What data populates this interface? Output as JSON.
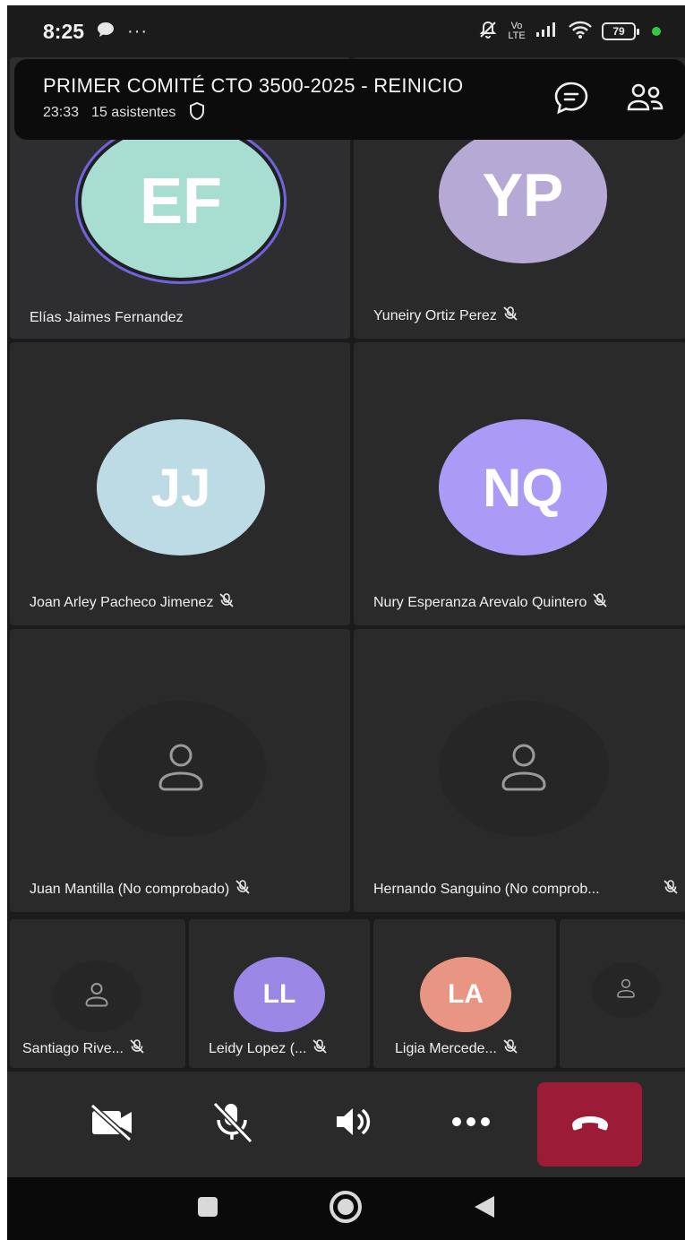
{
  "status_bar": {
    "time": "8:25",
    "more": "···",
    "network": "Vo LTE",
    "battery": "79"
  },
  "meeting": {
    "title": "PRIMER COMITÉ CTO 3500-2025 - REINICIO",
    "duration": "23:33",
    "attendees": "15 asistentes"
  },
  "participants": [
    {
      "initials": "EF",
      "name": "Elías Jaimes Fernandez",
      "color": "#a8ded2",
      "muted": false,
      "speaking": true
    },
    {
      "initials": "YP",
      "name": "Yuneiry Ortiz Perez",
      "color": "#b7a9d6",
      "muted": true
    },
    {
      "initials": "JJ",
      "name": "Joan Arley Pacheco Jimenez",
      "color": "#bcdbe5",
      "muted": true
    },
    {
      "initials": "NQ",
      "name": "Nury Esperanza Arevalo Quintero",
      "color": "#ab9bf6",
      "muted": true
    },
    {
      "initials": "",
      "name": "Juan Mantilla  (No comprobado)",
      "muted": true
    },
    {
      "initials": "",
      "name": "Hernando Sanguino (No comprob...",
      "muted": true
    },
    {
      "initials": "",
      "name": "Santiago Rive...",
      "muted": true
    },
    {
      "initials": "LL",
      "name": "Leidy Lopez (...",
      "color": "#9b87e6",
      "muted": true
    },
    {
      "initials": "LA",
      "name": "Ligia Mercede...",
      "color": "#e89584",
      "muted": true
    },
    {
      "initials": "",
      "name": "",
      "muted": false
    }
  ],
  "colors": {
    "background": "#1b1b1b",
    "tile": "#2a2a2a",
    "hangup": "#9c1b36",
    "speaking_ring": "#6f64d8"
  },
  "icons": {
    "chat": "chat-icon",
    "people": "people-icon",
    "shield": "shield-icon",
    "camera_off": "camera-off-icon",
    "mic_off": "mic-off-icon",
    "speaker": "speaker-icon",
    "more": "more-icon",
    "hangup": "hang-up-icon"
  }
}
